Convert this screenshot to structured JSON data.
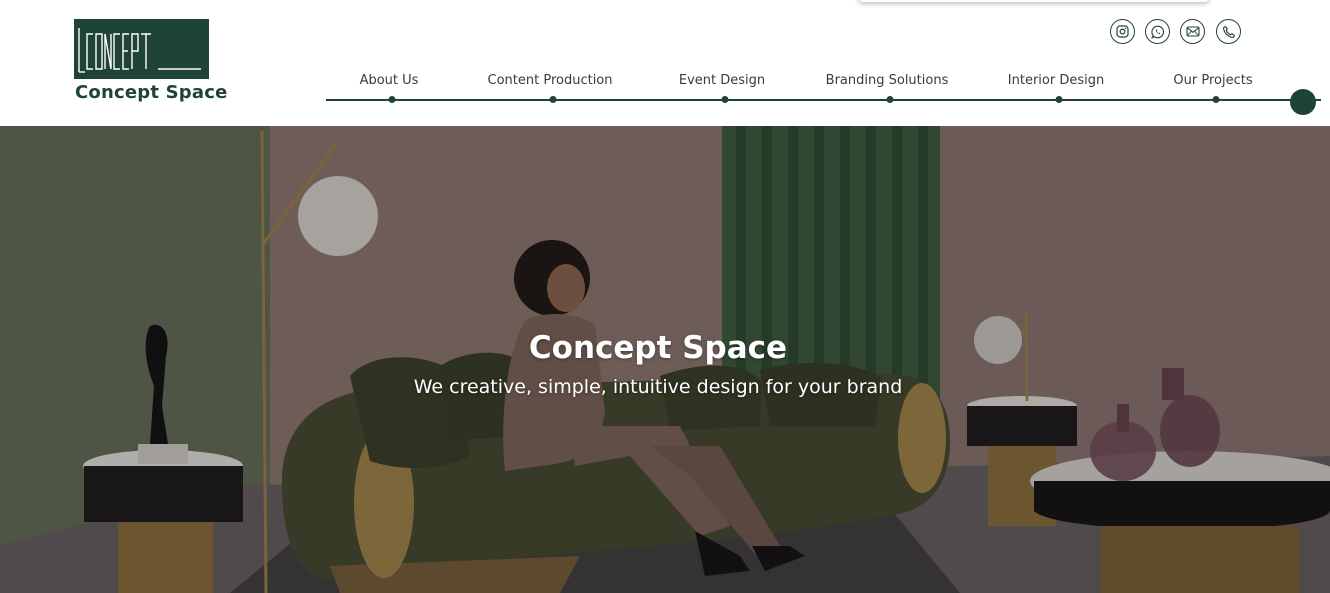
{
  "brand": {
    "logo_text": "CONCEPT",
    "name": "Concept Space",
    "color": "#1f4437"
  },
  "social_icons": [
    {
      "icon": "instagram-icon"
    },
    {
      "icon": "whatsapp-icon"
    },
    {
      "icon": "mail-icon"
    },
    {
      "icon": "phone-icon"
    }
  ],
  "nav": {
    "items": [
      {
        "label": "About Us"
      },
      {
        "label": "Content Production"
      },
      {
        "label": "Event Design"
      },
      {
        "label": "Branding Solutions"
      },
      {
        "label": "Interior Design"
      },
      {
        "label": "Our Projects"
      }
    ]
  },
  "hero": {
    "title": "Concept Space",
    "subtitle": "We creative, simple, intuitive design for your brand"
  }
}
